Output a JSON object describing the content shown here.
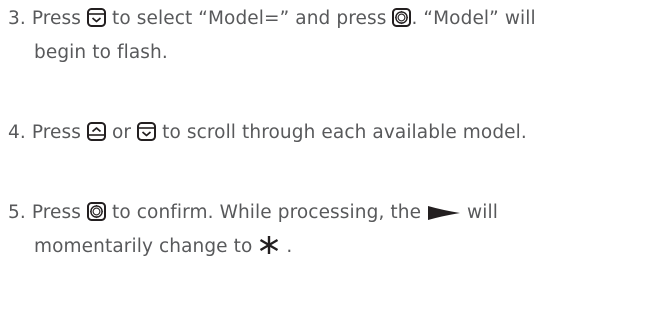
{
  "steps": [
    {
      "line1": {
        "prefix": "3. Press ",
        "icon1": "down-button-icon",
        "mid": " to select “Model=” and press ",
        "icon2": "enter-button-icon",
        "suffix": ". “Model” will"
      },
      "line2": "begin to flash."
    },
    {
      "line1": {
        "prefix": "4. Press ",
        "icon1": "up-button-icon",
        "mid": " or ",
        "icon2": "down-button-icon",
        "suffix": " to scroll through each available model."
      }
    },
    {
      "line1": {
        "prefix": "5. Press ",
        "icon1": "enter-button-icon",
        "mid": " to confirm. While processing, the ",
        "icon2": "play-arrow-icon",
        "suffix": " will"
      },
      "line2": {
        "prefix": "momentarily change to ",
        "icon": "asterisk-icon",
        "suffix": " ."
      }
    }
  ],
  "colors": {
    "text": "#58595b",
    "icon": "#231f20"
  }
}
